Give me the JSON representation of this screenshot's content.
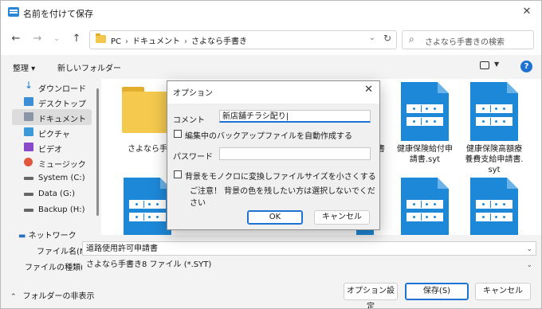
{
  "window": {
    "title": "名前を付けて保存",
    "close_glyph": "✕"
  },
  "nav": {
    "back": "←",
    "forward": "→",
    "dropdown": "⌄",
    "up": "↑",
    "breadcrumb": [
      "PC",
      "ドキュメント",
      "さよなら手書き"
    ],
    "address_dropdown": "⌄",
    "refresh": "↻",
    "search_placeholder": "さよなら手書きの検索"
  },
  "command_bar": {
    "organize_label": "整理 ▾",
    "new_folder_label": "新しいフォルダー"
  },
  "sidebar": {
    "items": [
      {
        "label": "ダウンロード",
        "icon": "download-icon"
      },
      {
        "label": "デスクトップ",
        "icon": "desktop-icon"
      },
      {
        "label": "ドキュメント",
        "icon": "documents-icon",
        "selected": true
      },
      {
        "label": "ピクチャ",
        "icon": "pictures-icon"
      },
      {
        "label": "ビデオ",
        "icon": "videos-icon"
      },
      {
        "label": "ミュージック",
        "icon": "music-icon"
      },
      {
        "label": "System (C:)",
        "icon": "drive-icon"
      },
      {
        "label": "Data (G:)",
        "icon": "drive-icon"
      },
      {
        "label": "Backup (H:)",
        "icon": "drive-icon"
      }
    ],
    "network_label": "ネットワーク"
  },
  "files": [
    {
      "name": "さよなら手書",
      "type": "folder"
    },
    {
      "name": "書",
      "type": "syt"
    },
    {
      "name": "健康保険給付申請書.syt",
      "type": "syt",
      "line1": "健康保険給付申",
      "line2": "請書.syt"
    },
    {
      "name": "健康保険高額療養費支給申請書.syt",
      "type": "syt",
      "line1": "健康保険高額療",
      "line2": "養費支給申請書.",
      "line3": "syt"
    }
  ],
  "footer": {
    "filename_label": "ファイル名(N):",
    "filename_value": "道路使用許可申請書",
    "filetype_label": "ファイルの種類(T):",
    "filetype_value": "さよなら手書き8 ファイル (*.SYT)",
    "hide_folders_label": "フォルダーの非表示",
    "options_button": "オプション設定",
    "save_button": "保存(S)",
    "cancel_button": "キャンセル"
  },
  "dialog": {
    "title": "オプション",
    "comment_label": "コメント",
    "comment_value": "新店舗チラシ配り|",
    "backup_checkbox_label": "編集中のバックアップファイルを自動作成する",
    "backup_checked": false,
    "password_label": "パスワード",
    "password_value": "",
    "mono_checkbox_label": "背景をモノクロに変換しファイルサイズを小さくする",
    "mono_checked": false,
    "note": "ご注意！ 背景の色を残したい方は選択しないでください",
    "ok_button": "OK",
    "cancel_button": "キャンセル"
  },
  "colors": {
    "accent": "#1e73d2",
    "file_icon_blue": "#1e88d8",
    "folder_yellow": "#f4c94e"
  }
}
